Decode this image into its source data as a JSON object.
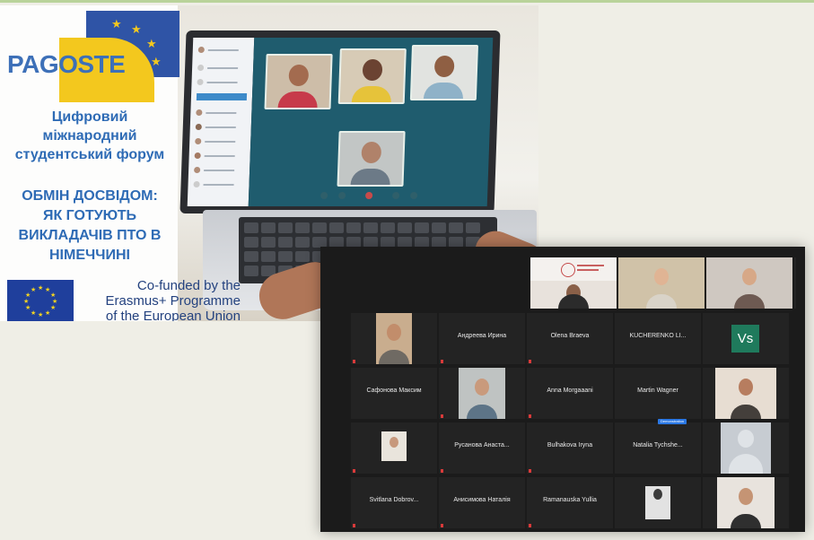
{
  "poster": {
    "logo_text": "PAGOSTE",
    "title_lines": [
      "Цифровий",
      "міжнародний",
      "студентський форум"
    ],
    "subtitle_lines": [
      "ОБМІН ДОСВІДОМ:",
      "ЯК ГОТУЮТЬ",
      "ВИКЛАДАЧІВ ПТО В",
      "НІМЕЧЧИНІ"
    ],
    "cofunded_lines": [
      "Co-funded by the",
      "Erasmus+ Programme",
      "of the European Union"
    ]
  },
  "meeting": {
    "rows": [
      [
        {
          "name": "",
          "kind": "certificate"
        },
        {
          "name": "",
          "kind": "video"
        },
        {
          "name": "",
          "kind": "video"
        },
        {
          "name": "",
          "kind": "video"
        }
      ],
      [
        {
          "name": "",
          "kind": "video"
        },
        {
          "name": "Андреева Ирина",
          "kind": "name"
        },
        {
          "name": "Olena Braeva",
          "kind": "name"
        },
        {
          "name": "KUCHERENKO LI...",
          "kind": "name"
        },
        {
          "name": "",
          "kind": "initials",
          "initials": "Vs"
        }
      ],
      [
        {
          "name": "Сафонова Максим",
          "kind": "name"
        },
        {
          "name": "",
          "kind": "video"
        },
        {
          "name": "Anna Morgaaani",
          "kind": "name"
        },
        {
          "name": "Martin Wagner",
          "kind": "name"
        },
        {
          "name": "",
          "kind": "video"
        }
      ],
      [
        {
          "name": "",
          "kind": "video"
        },
        {
          "name": "Русанова Анаста...",
          "kind": "name"
        },
        {
          "name": "Bulhakova Iryna",
          "kind": "name"
        },
        {
          "name": "Natalia Tychshe...",
          "kind": "name",
          "badge": "Demonstration"
        },
        {
          "name": "",
          "kind": "avatar"
        }
      ],
      [
        {
          "name": "Svitlana Dobrov...",
          "kind": "name"
        },
        {
          "name": "Анисимова Наталія",
          "kind": "name"
        },
        {
          "name": "Ramanauska Yullia",
          "kind": "name"
        },
        {
          "name": "",
          "kind": "video"
        },
        {
          "name": "",
          "kind": "video"
        }
      ]
    ]
  },
  "colors": {
    "poster_blue": "#2e6bb5",
    "logo_yellow": "#f3c81e",
    "eu_blue": "#1f3f9c",
    "gallery_bg": "#1b1b1b",
    "initials_bg": "#1f7a5c"
  },
  "icons": [
    "eu-flag-icon",
    "logo-star-icon",
    "mic-muted-icon",
    "user-avatar-icon"
  ]
}
